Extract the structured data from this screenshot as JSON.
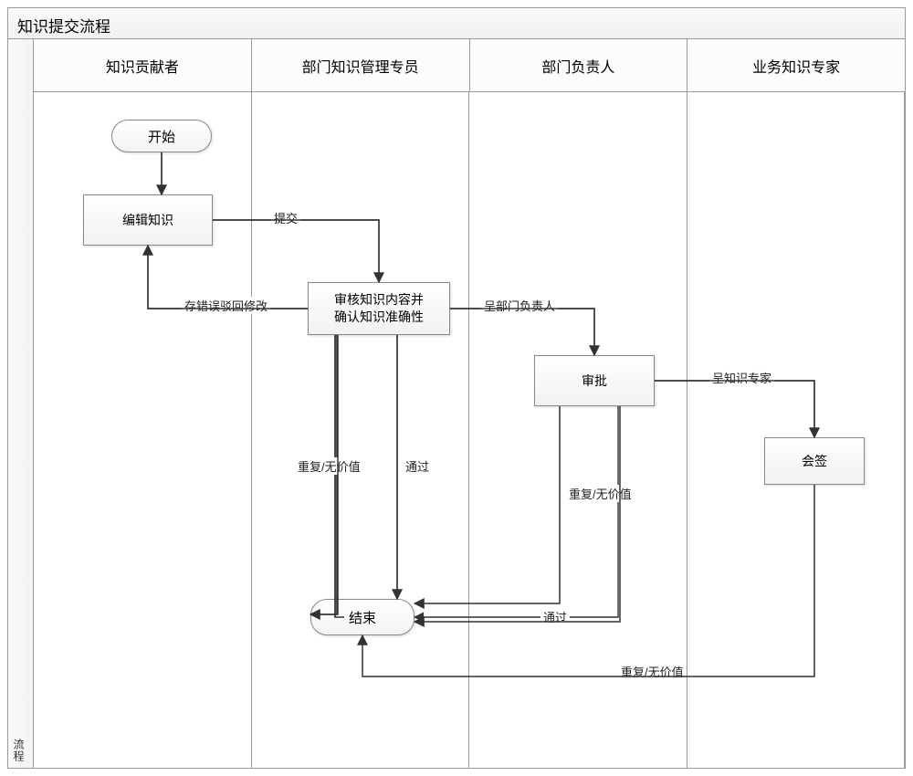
{
  "title": "知识提交流程",
  "sideTab": "流程",
  "lanes": {
    "l1": "知识贡献者",
    "l2": "部门知识管理专员",
    "l3": "部门负责人",
    "l4": "业务知识专家"
  },
  "nodes": {
    "start": "开始",
    "edit": "编辑知识",
    "review": "审核知识内容并\n确认知识准确性",
    "approve": "审批",
    "cosign": "会签",
    "end": "结束"
  },
  "edges": {
    "submit": "提交",
    "rejectEdit": "存错误驳回修改",
    "toDeptHead": "呈部门负责人",
    "toExpert": "呈知识专家",
    "pass1": "通过",
    "pass2": "通过",
    "dup1": "重复/无价值",
    "dup2": "重复/无价值",
    "dup3": "重复/无价值"
  }
}
